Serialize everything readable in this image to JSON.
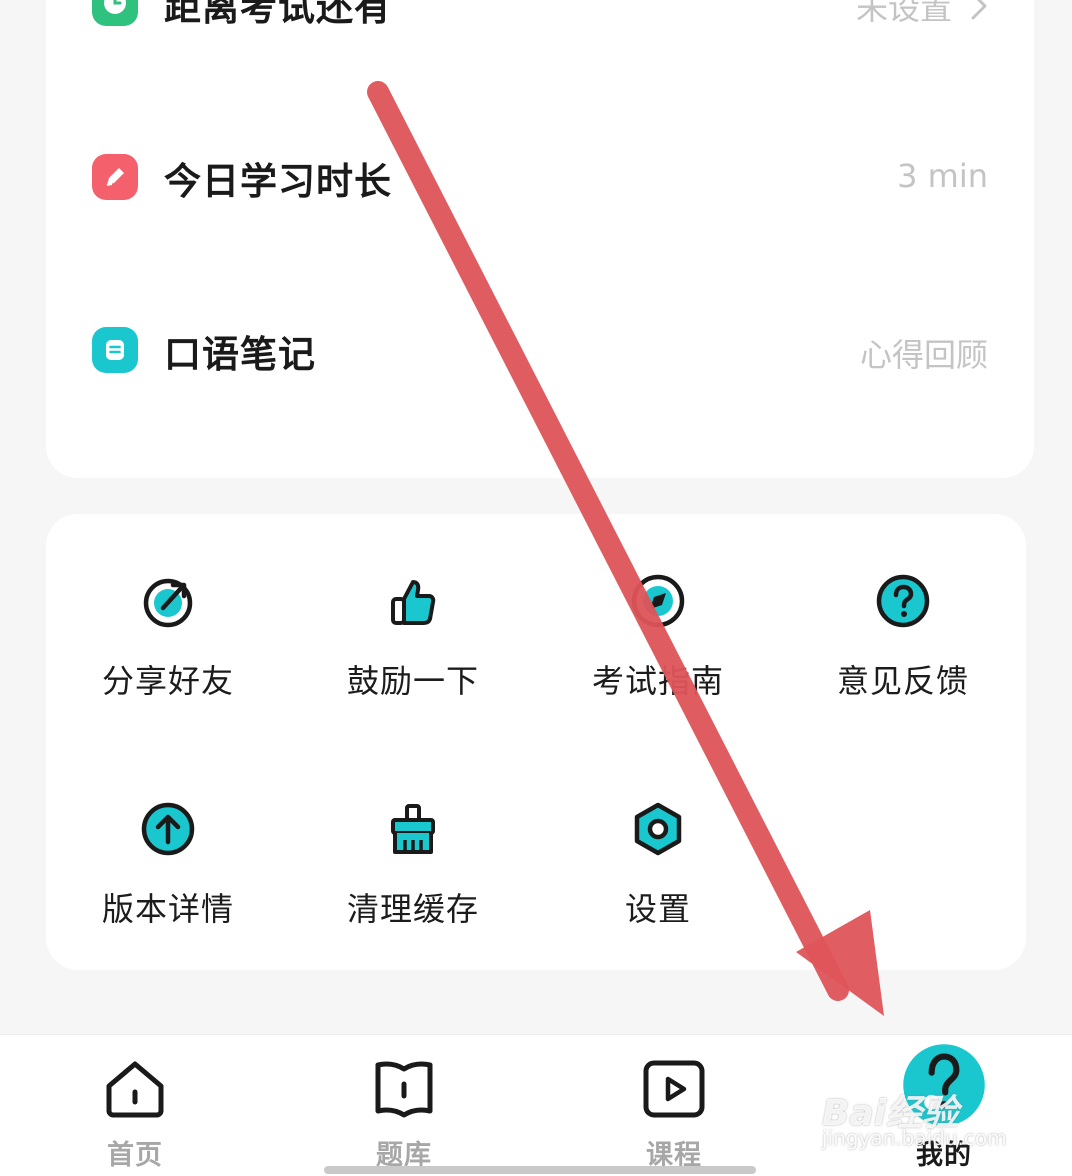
{
  "info_rows": [
    {
      "label": "距离考试还有",
      "value": "未设置",
      "icon": "clock-icon",
      "color": "#2ec27e"
    },
    {
      "label": "今日学习时长",
      "value": "3 min",
      "icon": "pencil-icon",
      "color": "#f4606c"
    },
    {
      "label": "口语笔记",
      "value": "心得回顾",
      "icon": "note-icon",
      "color": "#1bc7cf"
    }
  ],
  "menu": [
    {
      "label": "分享好友",
      "icon": "share-icon"
    },
    {
      "label": "鼓励一下",
      "icon": "thumbs-up-icon"
    },
    {
      "label": "考试指南",
      "icon": "compass-icon"
    },
    {
      "label": "意见反馈",
      "icon": "question-icon"
    },
    {
      "label": "版本详情",
      "icon": "upload-arrow-icon"
    },
    {
      "label": "清理缓存",
      "icon": "broom-icon"
    },
    {
      "label": "设置",
      "icon": "settings-hex-icon"
    }
  ],
  "tabs": [
    {
      "label": "首页",
      "icon": "home-icon"
    },
    {
      "label": "题库",
      "icon": "book-icon"
    },
    {
      "label": "课程",
      "icon": "play-icon"
    },
    {
      "label": "我的",
      "icon": "profile-face-icon",
      "active": true
    }
  ],
  "watermark": {
    "brand": "Bai经验",
    "url": "jingyan.baidu.com"
  },
  "colors": {
    "accent": "#1bc7cf",
    "arrow": "#de5459",
    "icon_stroke": "#1a1a1a"
  }
}
